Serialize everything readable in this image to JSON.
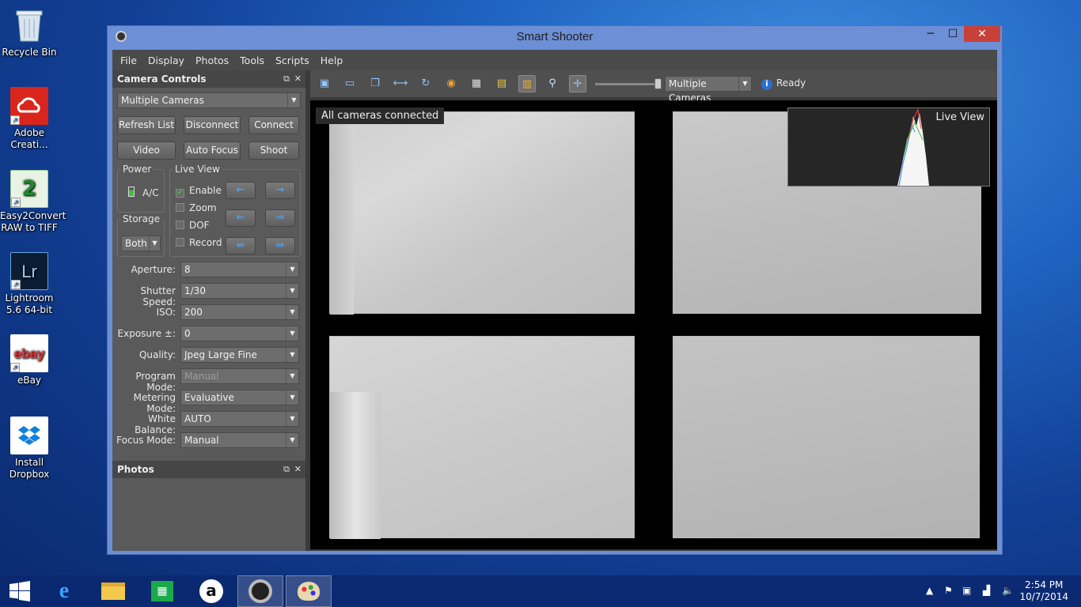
{
  "desktop": {
    "icons": [
      {
        "name": "recycle-bin",
        "label": "Recycle Bin"
      },
      {
        "name": "adobe-creative",
        "label": "Adobe Creati..."
      },
      {
        "name": "easy2convert",
        "label": "Easy2Convert RAW to TIFF"
      },
      {
        "name": "lightroom",
        "label": "Lightroom 5.6 64-bit",
        "glyph": "Lr"
      },
      {
        "name": "ebay",
        "label": "eBay",
        "glyph": "ebay"
      },
      {
        "name": "dropbox",
        "label": "Install Dropbox"
      }
    ]
  },
  "window": {
    "title": "Smart Shooter",
    "controls": {
      "minimize": "─",
      "maximize": "☐",
      "close": "✕"
    }
  },
  "menu": [
    "File",
    "Display",
    "Photos",
    "Tools",
    "Scripts",
    "Help"
  ],
  "camera_controls": {
    "title": "Camera Controls",
    "camera_select": "Multiple Cameras",
    "buttons": {
      "refresh": "Refresh List",
      "disconnect": "Disconnect",
      "connect": "Connect",
      "video": "Video",
      "autofocus": "Auto Focus",
      "shoot": "Shoot"
    },
    "power": {
      "label": "Power",
      "value": "A/C"
    },
    "storage": {
      "label": "Storage",
      "value": "Both"
    },
    "live_view": {
      "label": "Live View",
      "enable": {
        "label": "Enable",
        "checked": true
      },
      "zoom": {
        "label": "Zoom",
        "checked": false
      },
      "dof": {
        "label": "DOF",
        "checked": false
      },
      "record": {
        "label": "Record",
        "checked": false
      },
      "arrows": [
        "←",
        "→",
        "⇐",
        "⇒",
        "⇚",
        "⇛"
      ]
    },
    "properties": [
      {
        "label": "Aperture:",
        "value": "8",
        "disabled": false
      },
      {
        "label": "Shutter Speed:",
        "value": "1/30",
        "disabled": false
      },
      {
        "label": "ISO:",
        "value": "200",
        "disabled": false
      },
      {
        "label": "Exposure ±:",
        "value": "0",
        "disabled": false
      },
      {
        "label": "Quality:",
        "value": "Jpeg Large Fine",
        "disabled": false
      },
      {
        "label": "Program Mode:",
        "value": "Manual",
        "disabled": true
      },
      {
        "label": "Metering Mode:",
        "value": "Evaluative",
        "disabled": false
      },
      {
        "label": "White Balance:",
        "value": "AUTO",
        "disabled": false
      },
      {
        "label": "Focus Mode:",
        "value": "Manual",
        "disabled": false
      }
    ]
  },
  "photos_panel": {
    "title": "Photos"
  },
  "toolbar": {
    "camera_select": "Multiple Cameras",
    "status": "Ready",
    "zoom_fraction": 1.0
  },
  "preview": {
    "overlay": "All cameras connected",
    "live_view_label": "Live View"
  },
  "taskbar": {
    "time": "2:54 PM",
    "date": "10/7/2014"
  },
  "colors": {
    "window_frame": "#6c8fd6",
    "close_button": "#c7413a",
    "panel_bg": "#5a5a5a",
    "accent_blue": "#4aa8ff"
  }
}
